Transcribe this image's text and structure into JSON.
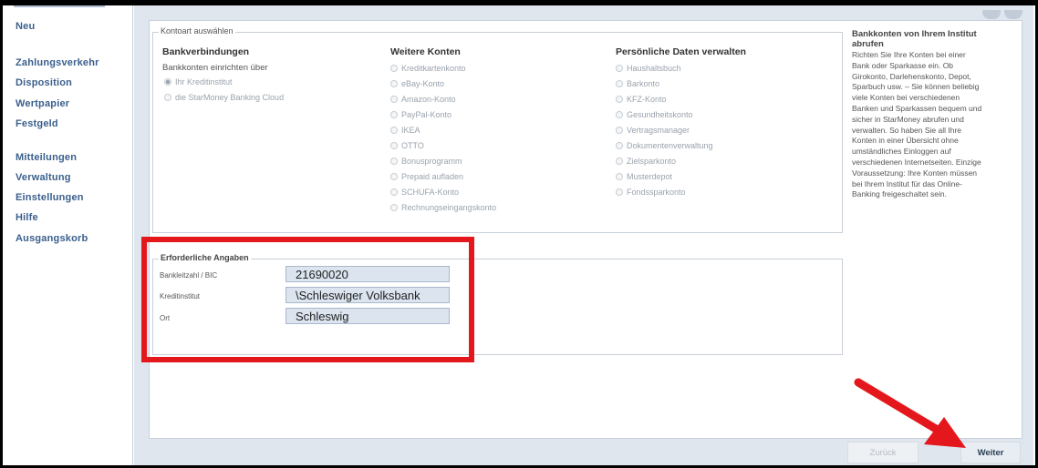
{
  "sidebar": {
    "items": [
      {
        "label": "Neu"
      },
      {
        "label": "Zahlungsverkehr"
      },
      {
        "label": "Disposition"
      },
      {
        "label": "Wertpapier"
      },
      {
        "label": "Festgeld"
      },
      {
        "label": "Mitteilungen"
      },
      {
        "label": "Verwaltung"
      },
      {
        "label": "Einstellungen"
      },
      {
        "label": "Hilfe"
      },
      {
        "label": "Ausgangskorb"
      }
    ]
  },
  "account_type": {
    "legend": "Kontoart auswählen",
    "bank_connections": {
      "heading": "Bankverbindungen",
      "sub_label": "Bankkonten einrichten über",
      "options": [
        {
          "label": "Ihr Kreditinstitut",
          "selected": true
        },
        {
          "label": "die StarMoney Banking Cloud",
          "selected": false
        }
      ]
    },
    "further_accounts": {
      "heading": "Weitere Konten",
      "options": [
        {
          "label": "Kreditkartenkonto"
        },
        {
          "label": "eBay-Konto"
        },
        {
          "label": "Amazon-Konto"
        },
        {
          "label": "PayPal-Konto"
        },
        {
          "label": "IKEA"
        },
        {
          "label": "OTTO"
        },
        {
          "label": "Bonusprogramm"
        },
        {
          "label": "Prepaid aufladen"
        },
        {
          "label": "SCHUFA-Konto"
        },
        {
          "label": "Rechnungseingangskonto"
        }
      ]
    },
    "personal_data": {
      "heading": "Persönliche Daten verwalten",
      "options": [
        {
          "label": "Haushaltsbuch"
        },
        {
          "label": "Barkonto"
        },
        {
          "label": "KFZ-Konto"
        },
        {
          "label": "Gesundheitskonto"
        },
        {
          "label": "Vertragsmanager"
        },
        {
          "label": "Dokumentenverwaltung"
        },
        {
          "label": "Zielsparkonto"
        },
        {
          "label": "Musterdepot"
        },
        {
          "label": "Fondssparkonto"
        }
      ]
    }
  },
  "info": {
    "title": "Bankkonten von Ihrem Institut abrufen",
    "body": "Richten Sie Ihre Konten bei einer Bank oder Sparkasse ein. Ob Girokonto, Darlehenskonto, Depot, Sparbuch usw. – Sie können beliebig viele Konten bei verschiedenen Banken und Sparkassen bequem und sicher in StarMoney abrufen und verwalten. So haben Sie all Ihre Konten in einer Übersicht ohne umständliches Einloggen auf verschiedenen Internetseiten. Einzige Voraussetzung: Ihre Konten müssen bei Ihrem Institut für das Online-Banking freigeschaltet sein."
  },
  "required": {
    "legend": "Erforderliche Angaben",
    "fields": [
      {
        "label": "Bankleitzahl / BIC",
        "value": "21690020"
      },
      {
        "label": "Kreditinstitut",
        "value": "\\Schleswiger Volksbank"
      },
      {
        "label": "Ort",
        "value": "Schleswig"
      }
    ]
  },
  "footer": {
    "back_label": "Zurück",
    "next_label": "Weiter"
  },
  "colors": {
    "highlight": "#e4181c",
    "nav_text": "#3a5f8c",
    "field_bg": "#dbe4ef"
  }
}
